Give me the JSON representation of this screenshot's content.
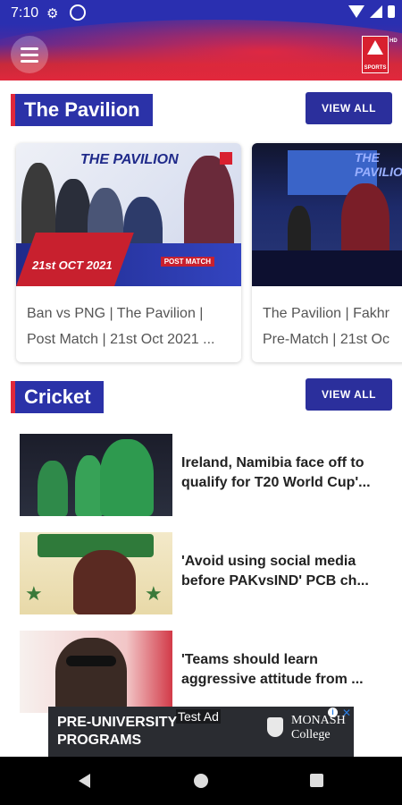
{
  "status_bar": {
    "time": "7:10"
  },
  "header": {
    "logo_label": "SPORTS",
    "logo_hd": "HD"
  },
  "sections": {
    "pavilion": {
      "title": "The Pavilion",
      "view_all": "VIEW ALL",
      "cards": [
        {
          "caption": "Ban vs PNG | The Pavilion |\nPost Match | 21st Oct 2021 ...",
          "thumb_title": "THE PAVILION",
          "thumb_date": "21st OCT 2021",
          "thumb_badge": "POST MATCH"
        },
        {
          "caption": "The Pavilion | Fakhr\nPre-Match | 21st Oc",
          "thumb_title": "THE PAVILION"
        }
      ]
    },
    "cricket": {
      "title": "Cricket",
      "view_all": "VIEW ALL",
      "items": [
        {
          "title": "Ireland, Namibia face off to\nqualify for T20 World Cup'..."
        },
        {
          "title": "'Avoid using social media\nbefore PAKvsIND' PCB ch..."
        },
        {
          "title": "'Teams should learn\naggressive attitude from ..."
        }
      ]
    }
  },
  "ad": {
    "headline": "PRE-UNIVERSITY\nPROGRAMS",
    "tag": "Test Ad",
    "brand": "MONASH\nCollege"
  },
  "colors": {
    "primary_blue": "#2b32a8",
    "accent_red": "#e0283c"
  }
}
